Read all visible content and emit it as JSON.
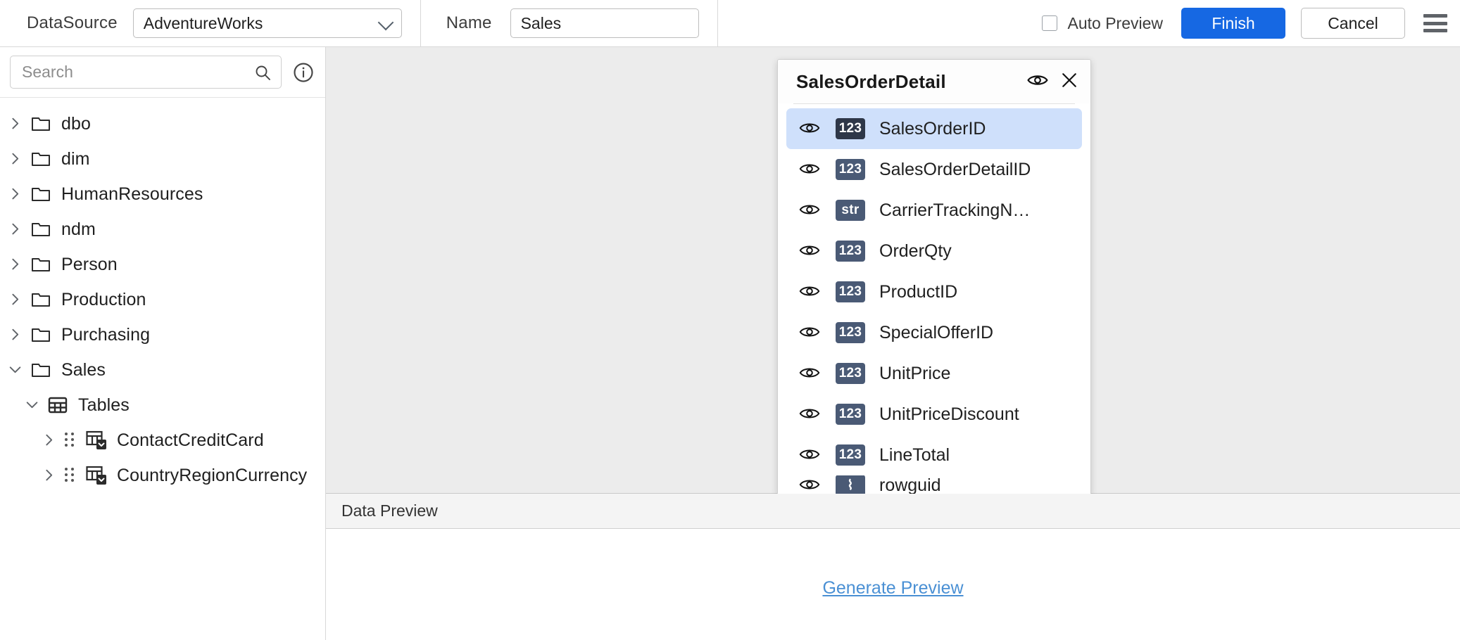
{
  "topbar": {
    "datasource_label": "DataSource",
    "datasource_value": "AdventureWorks",
    "name_label": "Name",
    "name_value": "Sales",
    "name_placeholder": "Name",
    "auto_preview_label": "Auto Preview",
    "auto_preview_checked": false,
    "finish_label": "Finish",
    "cancel_label": "Cancel",
    "primary_color": "#1668e3"
  },
  "sidebar": {
    "search_placeholder": "Search",
    "search_value": "",
    "tree": [
      {
        "label": "dbo",
        "icon": "folder-icon",
        "expanded": false,
        "level": 1
      },
      {
        "label": "dim",
        "icon": "folder-icon",
        "expanded": false,
        "level": 1
      },
      {
        "label": "HumanResources",
        "icon": "folder-icon",
        "expanded": false,
        "level": 1
      },
      {
        "label": "ndm",
        "icon": "folder-icon",
        "expanded": false,
        "level": 1
      },
      {
        "label": "Person",
        "icon": "folder-icon",
        "expanded": false,
        "level": 1
      },
      {
        "label": "Production",
        "icon": "folder-icon",
        "expanded": false,
        "level": 1
      },
      {
        "label": "Purchasing",
        "icon": "folder-icon",
        "expanded": false,
        "level": 1
      },
      {
        "label": "Sales",
        "icon": "folder-icon",
        "expanded": true,
        "level": 1
      },
      {
        "label": "Tables",
        "icon": "grid-icon",
        "expanded": true,
        "level": 2
      },
      {
        "label": "ContactCreditCard",
        "icon": "table-icon",
        "expanded": false,
        "level": 3,
        "draggable": true
      },
      {
        "label": "CountryRegionCurrency",
        "icon": "table-icon",
        "expanded": false,
        "level": 3,
        "draggable": true
      }
    ]
  },
  "fields_panel": {
    "title": "SalesOrderDetail",
    "visibility_icon": "eye-icon",
    "close_icon": "close-icon",
    "fields": [
      {
        "name": "SalesOrderID",
        "type": "123",
        "selected": true
      },
      {
        "name": "SalesOrderDetailID",
        "type": "123",
        "selected": false
      },
      {
        "name": "CarrierTrackingN…",
        "type": "str",
        "selected": false
      },
      {
        "name": "OrderQty",
        "type": "123",
        "selected": false
      },
      {
        "name": "ProductID",
        "type": "123",
        "selected": false
      },
      {
        "name": "SpecialOfferID",
        "type": "123",
        "selected": false
      },
      {
        "name": "UnitPrice",
        "type": "123",
        "selected": false
      },
      {
        "name": "UnitPriceDiscount",
        "type": "123",
        "selected": false
      },
      {
        "name": "LineTotal",
        "type": "123",
        "selected": false
      },
      {
        "name": "rowguid",
        "type": "⌇",
        "selected": false,
        "clipped": true
      }
    ],
    "selected_color": "#cfe0fb",
    "badge_color": "#4a5a75"
  },
  "preview": {
    "title": "Data Preview",
    "generate_link": "Generate Preview",
    "link_color": "#4a90d4"
  }
}
